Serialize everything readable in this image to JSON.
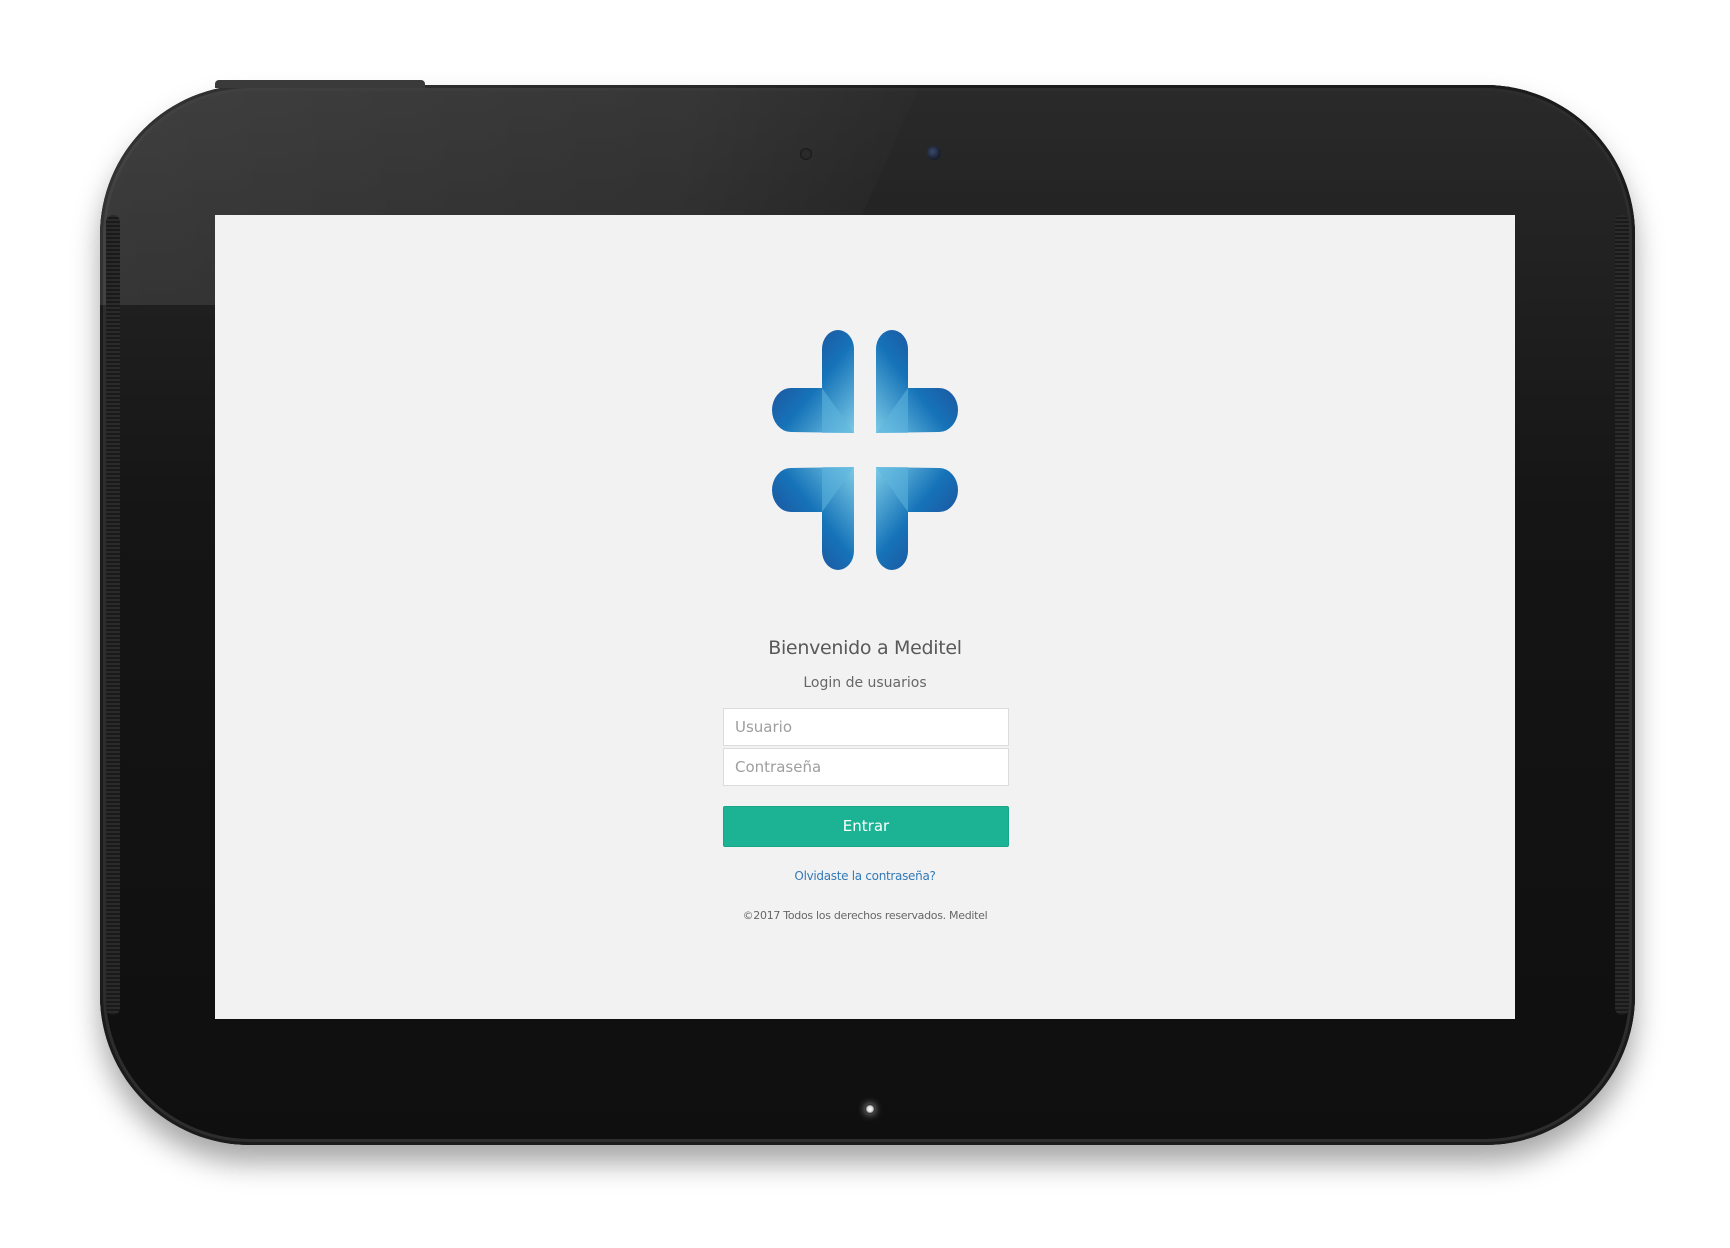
{
  "login": {
    "welcome": "Bienvenido a Meditel",
    "subtitle": "Login de usuarios",
    "username_placeholder": "Usuario",
    "password_placeholder": "Contraseña",
    "submit_label": "Entrar",
    "forgot_label": "Olvidaste la contraseña?",
    "copyright": "©2017 Todos los derechos reservados. Meditel"
  },
  "colors": {
    "screen_bg": "#f2f2f2",
    "button": "#1bb394",
    "link": "#337ab7",
    "logo_dark": "#233a8a",
    "logo_mid": "#1673b8",
    "logo_light": "#7ccbe6"
  },
  "icons": {
    "logo": "meditel-cross-logo"
  }
}
